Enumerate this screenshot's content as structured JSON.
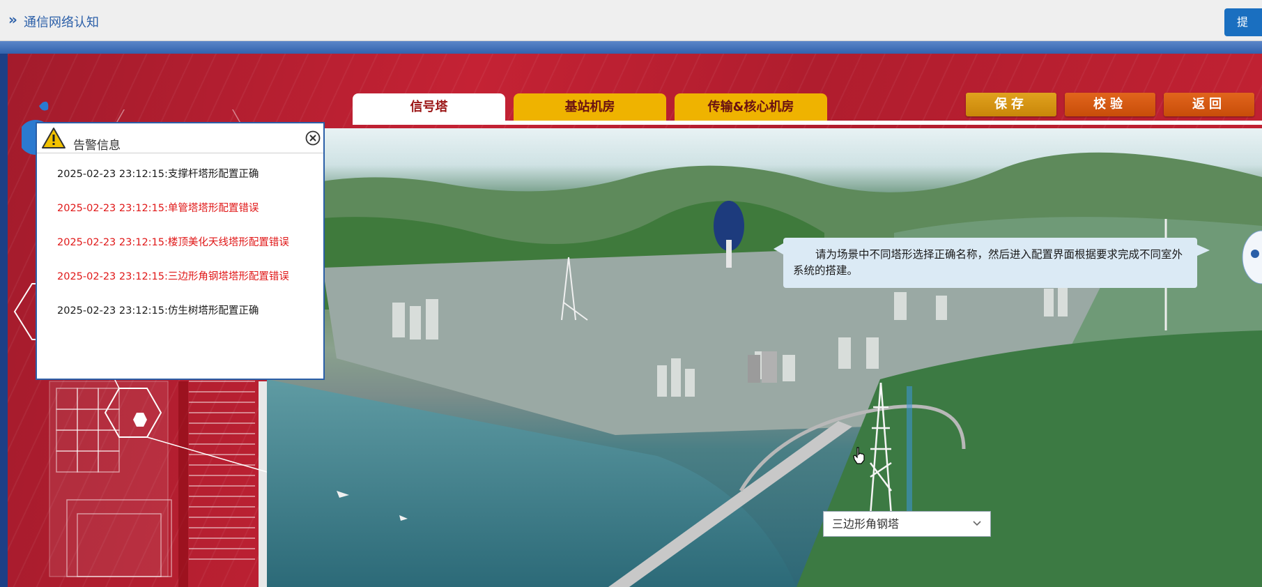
{
  "topbar": {
    "title": "通信网络认知",
    "submit_label": "提",
    "chevron_glyph": "»"
  },
  "tabs": [
    {
      "label": "信号塔",
      "active": true
    },
    {
      "label": "基站机房",
      "active": false
    },
    {
      "label": "传输&核心机房",
      "active": false
    }
  ],
  "actions": {
    "save_label": "保存",
    "check_label": "校验",
    "back_label": "返回"
  },
  "alert": {
    "title": "告警信息",
    "items": [
      {
        "text": "2025-02-23 23:12:15:支撑杆塔形配置正确",
        "status": "ok"
      },
      {
        "text": "2025-02-23 23:12:15:单管塔塔形配置错误",
        "status": "error"
      },
      {
        "text": "2025-02-23 23:12:15:楼顶美化天线塔形配置错误",
        "status": "error"
      },
      {
        "text": "2025-02-23 23:12:15:三边形角钢塔塔形配置错误",
        "status": "error"
      },
      {
        "text": "2025-02-23 23:12:15:仿生树塔形配置正确",
        "status": "ok"
      }
    ]
  },
  "hint": {
    "text": "请为场景中不同塔形选择正确名称，然后进入配置界面根据要求完成不同室外系统的搭建。"
  },
  "tower_select": {
    "value": "三边形角钢塔"
  },
  "colors": {
    "accent_blue": "#2b5fa8",
    "tab_gold": "#efb300",
    "error_red": "#e01818",
    "stage_red": "#c42234"
  }
}
